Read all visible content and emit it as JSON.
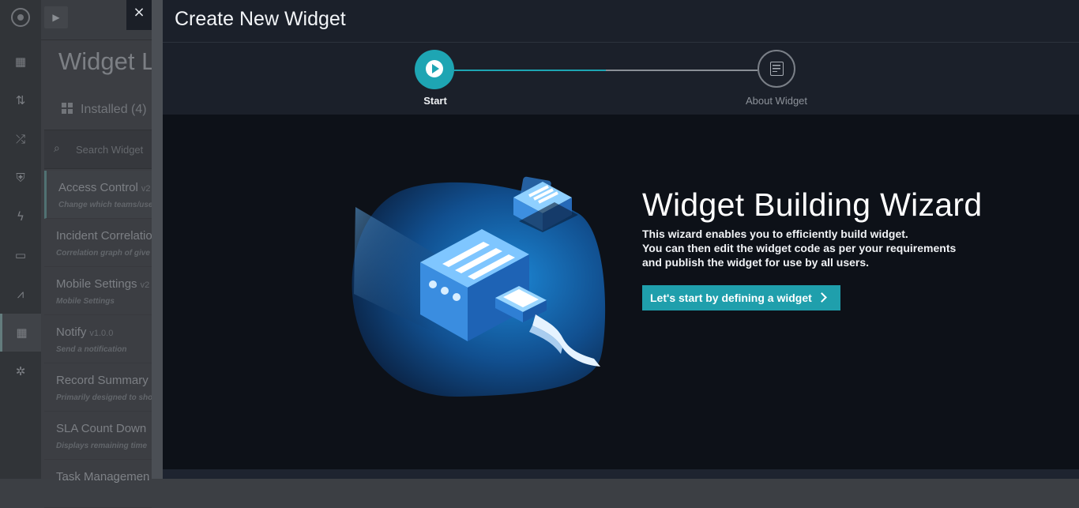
{
  "background": {
    "page_title": "Widget L",
    "installed_tab": "Installed (4)",
    "search_placeholder": "Search Widget",
    "widgets": [
      {
        "name": "Access Control",
        "version": "v2",
        "desc": "Change which teams/use"
      },
      {
        "name": "Incident Correlatio",
        "version": "",
        "desc": "Correlation graph of give"
      },
      {
        "name": "Mobile Settings",
        "version": "v2",
        "desc": "Mobile Settings"
      },
      {
        "name": "Notify",
        "version": "v1.0.0",
        "desc": "Send a notification"
      },
      {
        "name": "Record Summary",
        "version": "",
        "desc": "Primarily designed to sho"
      },
      {
        "name": "SLA Count Down",
        "version": "",
        "desc": "Displays remaining time"
      },
      {
        "name": "Task Managemen",
        "version": "",
        "desc": ""
      }
    ],
    "rail_icons": [
      "dashboard-icon",
      "import-export-icon",
      "shuffle-icon",
      "shield-icon",
      "lightning-icon",
      "briefcase-icon",
      "chart-icon",
      "widgets-icon",
      "settings-icon"
    ]
  },
  "modal": {
    "close_glyph": "×",
    "title": "Create New Widget",
    "steps": [
      {
        "label": "Start",
        "state": "active"
      },
      {
        "label": "About Widget",
        "state": "inactive"
      }
    ],
    "progress": 0.5,
    "hero_title": "Widget Building Wizard",
    "hero_lines": [
      "This wizard enables you to efficiently build widget.",
      "You can then edit the widget code as per your requirements",
      "and publish the widget for use by all users."
    ],
    "cta_label": "Let's start by defining a widget",
    "colors": {
      "accent": "#1ea5b3",
      "modal_bg": "#0d1118",
      "header_bg": "#1b202a"
    }
  }
}
